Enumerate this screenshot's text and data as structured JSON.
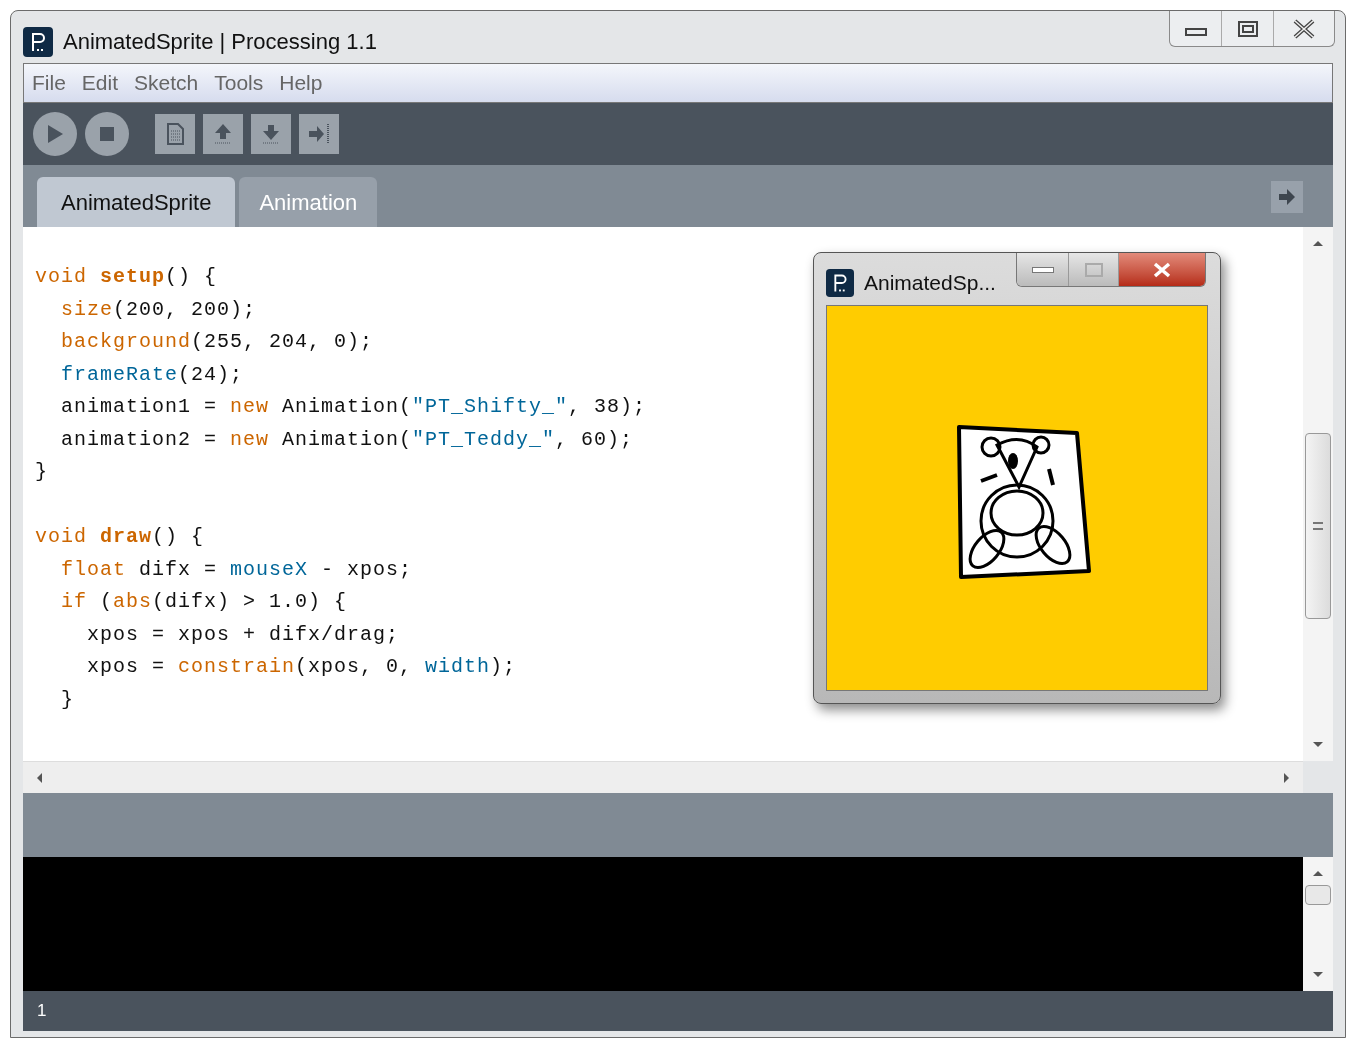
{
  "window": {
    "title": "AnimatedSprite | Processing 1.1"
  },
  "menu": [
    "File",
    "Edit",
    "Sketch",
    "Tools",
    "Help"
  ],
  "tabs": [
    {
      "label": "AnimatedSprite",
      "selected": true
    },
    {
      "label": "Animation",
      "selected": false
    }
  ],
  "editor": {
    "blocks": [
      {
        "lines": [
          [
            {
              "t": "void ",
              "kind": "keyword"
            },
            {
              "t": "setup",
              "kind": "keyword_bold"
            },
            {
              "t": "() {",
              "kind": "plain"
            }
          ],
          [
            {
              "t": "  size",
              "kind": "keyword"
            },
            {
              "t": "(200, 200);",
              "kind": "plain"
            }
          ],
          [
            {
              "t": "  background",
              "kind": "keyword"
            },
            {
              "t": "(255, 204, 0);",
              "kind": "plain"
            }
          ],
          [
            {
              "t": "  frameRate",
              "kind": "builtin"
            },
            {
              "t": "(24);",
              "kind": "plain"
            }
          ],
          [
            {
              "t": "  animation1 = ",
              "kind": "plain"
            },
            {
              "t": "new",
              "kind": "keyword"
            },
            {
              "t": " Animation(",
              "kind": "plain"
            },
            {
              "t": "\"PT_Shifty_\"",
              "kind": "string"
            },
            {
              "t": ", 38);",
              "kind": "plain"
            }
          ],
          [
            {
              "t": "  animation2 = ",
              "kind": "plain"
            },
            {
              "t": "new",
              "kind": "keyword"
            },
            {
              "t": " Animation(",
              "kind": "plain"
            },
            {
              "t": "\"PT_Teddy_\"",
              "kind": "string"
            },
            {
              "t": ", 60);",
              "kind": "plain"
            }
          ],
          [
            {
              "t": "}",
              "kind": "plain"
            }
          ]
        ]
      },
      {
        "lines": [
          [
            {
              "t": "void ",
              "kind": "keyword"
            },
            {
              "t": "draw",
              "kind": "keyword_bold"
            },
            {
              "t": "() {",
              "kind": "plain"
            }
          ],
          [
            {
              "t": "  float",
              "kind": "keyword"
            },
            {
              "t": " difx = ",
              "kind": "plain"
            },
            {
              "t": "mouseX",
              "kind": "builtin"
            },
            {
              "t": " - xpos;",
              "kind": "plain"
            }
          ],
          [
            {
              "t": "  if",
              "kind": "keyword"
            },
            {
              "t": " (",
              "kind": "plain"
            },
            {
              "t": "abs",
              "kind": "keyword"
            },
            {
              "t": "(difx) > 1.0) {",
              "kind": "plain"
            }
          ],
          [
            {
              "t": "    xpos = xpos + difx/drag;",
              "kind": "plain"
            }
          ],
          [
            {
              "t": "    xpos = ",
              "kind": "plain"
            },
            {
              "t": "constrain",
              "kind": "keyword"
            },
            {
              "t": "(xpos, 0, ",
              "kind": "plain"
            },
            {
              "t": "width",
              "kind": "builtin"
            },
            {
              "t": ");",
              "kind": "plain"
            }
          ],
          [
            {
              "t": "  }",
              "kind": "plain"
            }
          ]
        ]
      }
    ]
  },
  "sketch_window": {
    "title": "AnimatedSp..."
  },
  "status_bar": {
    "line": "1"
  }
}
